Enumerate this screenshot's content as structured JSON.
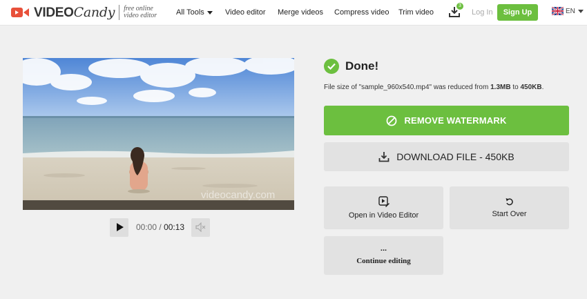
{
  "header": {
    "logo_text_bold": "VIDEO",
    "logo_text_italic": "Candy",
    "logo_tagline_1": "free online",
    "logo_tagline_2": "video editor",
    "nav": [
      {
        "label": "All Tools",
        "has_caret": true
      },
      {
        "label": "Video editor"
      },
      {
        "label": "Merge videos"
      },
      {
        "label": "Compress video"
      },
      {
        "label": "Trim video"
      }
    ],
    "download_badge": "3",
    "login_label": "Log In",
    "signup_label": "Sign Up",
    "language": "EN"
  },
  "player": {
    "watermark": "videocandy.com",
    "current_time": "00:00",
    "separator": "/",
    "duration": "00:13",
    "icons": [
      "play-icon",
      "volume-icon"
    ]
  },
  "result": {
    "title": "Done!",
    "info_prefix": "File size of \"sample_960x540.mp4\" was reduced from ",
    "size_from": "1.3MB",
    "info_mid": " to ",
    "size_to": "450KB",
    "info_suffix": ".",
    "remove_watermark_label": "REMOVE WATERMARK",
    "download_label": "DOWNLOAD FILE - 450KB",
    "open_editor_label": "Open in Video Editor",
    "start_over_label": "Start Over",
    "continue_dots": "...",
    "continue_label": "Continue editing"
  },
  "colors": {
    "accent": "#6cbf3f",
    "brand_red": "#e8503a",
    "button_gray": "#e2e2e2",
    "page_bg": "#f0f0f0"
  }
}
